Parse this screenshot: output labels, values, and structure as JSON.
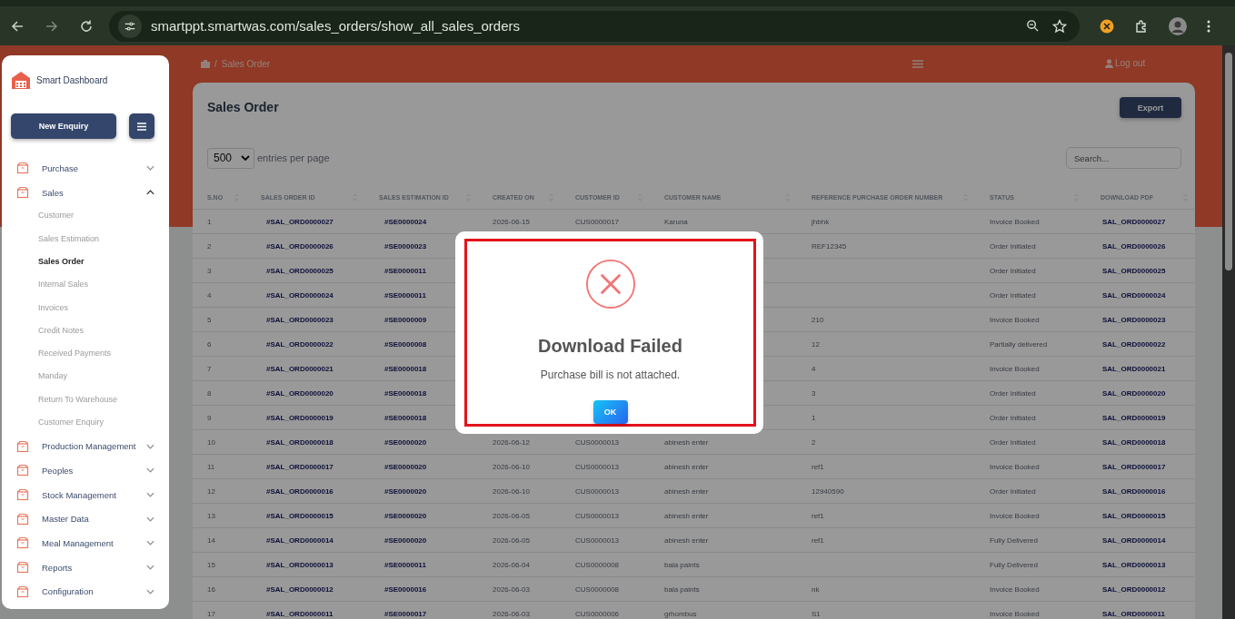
{
  "browser": {
    "url": "smartppt.smartwas.com/sales_orders/show_all_sales_orders"
  },
  "sidebar": {
    "brand": "Smart Dashboard",
    "new_button": "New Enquiry",
    "items": [
      {
        "label": "Purchase",
        "expanded": false
      },
      {
        "label": "Sales",
        "expanded": true,
        "children": [
          {
            "label": "Customer",
            "selected": false
          },
          {
            "label": "Sales Estimation",
            "selected": false
          },
          {
            "label": "Sales Order",
            "selected": true
          },
          {
            "label": "Internal Sales",
            "selected": false
          },
          {
            "label": "Invoices",
            "selected": false
          },
          {
            "label": "Credit Notes",
            "selected": false
          },
          {
            "label": "Received Payments",
            "selected": false
          },
          {
            "label": "Manday",
            "selected": false
          },
          {
            "label": "Return To Warehouse",
            "selected": false
          },
          {
            "label": "Customer Enquiry",
            "selected": false
          }
        ]
      },
      {
        "label": "Production Management",
        "expanded": false
      },
      {
        "label": "Peoples",
        "expanded": false
      },
      {
        "label": "Stock Management",
        "expanded": false
      },
      {
        "label": "Master Data",
        "expanded": false
      },
      {
        "label": "Meal Management",
        "expanded": false
      },
      {
        "label": "Reports",
        "expanded": false
      },
      {
        "label": "Configuration",
        "expanded": false
      }
    ]
  },
  "header": {
    "breadcrumb_separator": "/",
    "breadcrumb": "Sales Order",
    "logout": "Log out"
  },
  "page": {
    "title": "Sales Order",
    "export_button": "Export",
    "page_size": "500",
    "page_size_label": "entries per page",
    "search_placeholder": "Search..."
  },
  "table": {
    "columns": [
      "S.NO",
      "SALES ORDER ID",
      "SALES ESTIMATION ID",
      "CREATED ON",
      "CUSTOMER ID",
      "CUSTOMER NAME",
      "REFERENCE PURCHASE ORDER NUMBER",
      "STATUS",
      "DOWNLOAD PDF"
    ],
    "rows": [
      [
        "1",
        "#SAL_ORD0000027",
        "#SE0000024",
        "2026-06-15",
        "CUS0000017",
        "Karuna",
        "jhbhk",
        "Invoice Booked",
        "SAL_ORD0000027"
      ],
      [
        "2",
        "#SAL_ORD0000026",
        "#SE0000023",
        null,
        null,
        null,
        "REF12345",
        "Order Initiated",
        "SAL_ORD0000026"
      ],
      [
        "3",
        "#SAL_ORD0000025",
        "#SE0000011",
        null,
        null,
        null,
        null,
        "Order Initiated",
        "SAL_ORD0000025"
      ],
      [
        "4",
        "#SAL_ORD0000024",
        "#SE0000011",
        null,
        null,
        null,
        null,
        "Order Initiated",
        "SAL_ORD0000024"
      ],
      [
        "5",
        "#SAL_ORD0000023",
        "#SE0000009",
        null,
        null,
        null,
        "210",
        "Invoice Booked",
        "SAL_ORD0000023"
      ],
      [
        "6",
        "#SAL_ORD0000022",
        "#SE0000008",
        null,
        null,
        null,
        "12",
        "Partially delivered",
        "SAL_ORD0000022"
      ],
      [
        "7",
        "#SAL_ORD0000021",
        "#SE0000018",
        null,
        null,
        null,
        "4",
        "Invoice Booked",
        "SAL_ORD0000021"
      ],
      [
        "8",
        "#SAL_ORD0000020",
        "#SE0000018",
        null,
        null,
        null,
        "3",
        "Order Initiated",
        "SAL_ORD0000020"
      ],
      [
        "9",
        "#SAL_ORD0000019",
        "#SE0000018",
        null,
        null,
        null,
        "1",
        "Order Initiated",
        "SAL_ORD0000019"
      ],
      [
        "10",
        "#SAL_ORD0000018",
        "#SE0000020",
        "2026-06-12",
        "CUS0000013",
        "abinesh enter",
        "2",
        "Order Initiated",
        "SAL_ORD0000018"
      ],
      [
        "11",
        "#SAL_ORD0000017",
        "#SE0000020",
        "2026-06-10",
        "CUS0000013",
        "abinesh enter",
        "ref1",
        "Invoice Booked",
        "SAL_ORD0000017"
      ],
      [
        "12",
        "#SAL_ORD0000016",
        "#SE0000020",
        "2026-06-10",
        "CUS0000013",
        "abinesh enter",
        "12940590",
        "Order Initiated",
        "SAL_ORD0000016"
      ],
      [
        "13",
        "#SAL_ORD0000015",
        "#SE0000020",
        "2026-06-05",
        "CUS0000013",
        "abinesh enter",
        "ref1",
        "Invoice Booked",
        "SAL_ORD0000015"
      ],
      [
        "14",
        "#SAL_ORD0000014",
        "#SE0000020",
        "2026-06-05",
        "CUS0000013",
        "abinesh enter",
        "ref1",
        "Fully Delivered",
        "SAL_ORD0000014"
      ],
      [
        "15",
        "#SAL_ORD0000013",
        "#SE0000011",
        "2026-06-04",
        "CUS0000008",
        "bala paints",
        null,
        "Fully Delivered",
        "SAL_ORD0000013"
      ],
      [
        "16",
        "#SAL_ORD0000012",
        "#SE0000016",
        "2026-06-03",
        "CUS0000008",
        "bala paints",
        "nk",
        "Invoice Booked",
        "SAL_ORD0000012"
      ],
      [
        "17",
        "#SAL_ORD0000011",
        "#SE0000017",
        "2026-06-03",
        "CUS0000006",
        "grhombus",
        "S1",
        "Invoice Booked",
        "SAL_ORD0000011"
      ]
    ]
  },
  "dialog": {
    "title": "Download Failed",
    "message": "Purchase bill is not attached.",
    "ok_button": "OK"
  }
}
